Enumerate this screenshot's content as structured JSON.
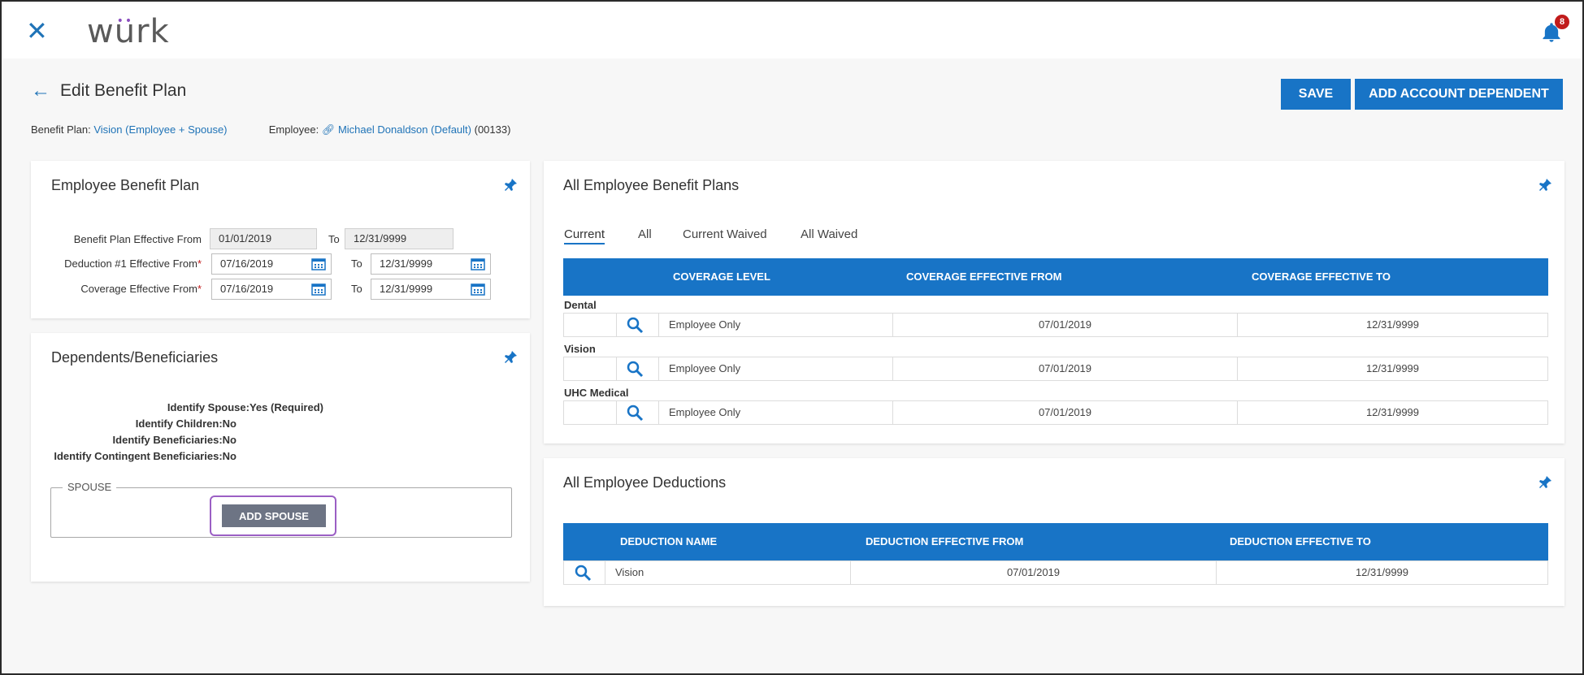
{
  "app": {
    "logo_text": "wurk",
    "notification_count": "8"
  },
  "header": {
    "title": "Edit Benefit Plan",
    "save_label": "SAVE",
    "add_dependent_label": "ADD ACCOUNT DEPENDENT"
  },
  "meta": {
    "benefit_plan_label": "Benefit Plan:",
    "benefit_plan_value": "Vision (Employee + Spouse)",
    "employee_label": "Employee:",
    "employee_value": "Michael Donaldson (Default)",
    "employee_id": "(00133)"
  },
  "ebp": {
    "title": "Employee Benefit Plan",
    "rows": [
      {
        "label": "Benefit Plan Effective From",
        "required": false,
        "from": "01/01/2019",
        "to_label": "To",
        "to": "12/31/9999"
      },
      {
        "label": "Deduction #1 Effective From",
        "required": true,
        "from": "07/16/2019",
        "to_label": "To",
        "to": "12/31/9999"
      },
      {
        "label": "Coverage Effective From",
        "required": true,
        "from": "07/16/2019",
        "to_label": "To",
        "to": "12/31/9999"
      }
    ],
    "required_mark": "*"
  },
  "dependents": {
    "title": "Dependents/Beneficiaries",
    "lines": [
      {
        "key": "Identify Spouse:",
        "value": "Yes (Required)"
      },
      {
        "key": "Identify Children:",
        "value": "No"
      },
      {
        "key": "Identify Beneficiaries:",
        "value": "No"
      },
      {
        "key": "Identify Contingent Beneficiaries:",
        "value": "No"
      }
    ],
    "spouse_legend": "SPOUSE",
    "add_spouse_label": "ADD SPOUSE"
  },
  "all_plans": {
    "title": "All Employee Benefit Plans",
    "tabs": [
      "Current",
      "All",
      "Current Waived",
      "All Waived"
    ],
    "columns": [
      "COVERAGE LEVEL",
      "COVERAGE EFFECTIVE FROM",
      "COVERAGE EFFECTIVE TO"
    ],
    "groups": [
      {
        "name": "Dental",
        "level": "Employee Only",
        "from": "07/01/2019",
        "to": "12/31/9999"
      },
      {
        "name": "Vision",
        "level": "Employee Only",
        "from": "07/01/2019",
        "to": "12/31/9999"
      },
      {
        "name": "UHC Medical",
        "level": "Employee Only",
        "from": "07/01/2019",
        "to": "12/31/9999"
      }
    ]
  },
  "deductions": {
    "title": "All Employee Deductions",
    "columns": [
      "DEDUCTION NAME",
      "DEDUCTION EFFECTIVE FROM",
      "DEDUCTION EFFECTIVE TO"
    ],
    "rows": [
      {
        "name": "Vision",
        "from": "07/01/2019",
        "to": "12/31/9999"
      }
    ]
  },
  "colors": {
    "brand_blue": "#1874c6",
    "badge_red": "#c11b1b",
    "focus_purple": "#9b5fc4",
    "logo_dots": "#8b4fbf"
  }
}
